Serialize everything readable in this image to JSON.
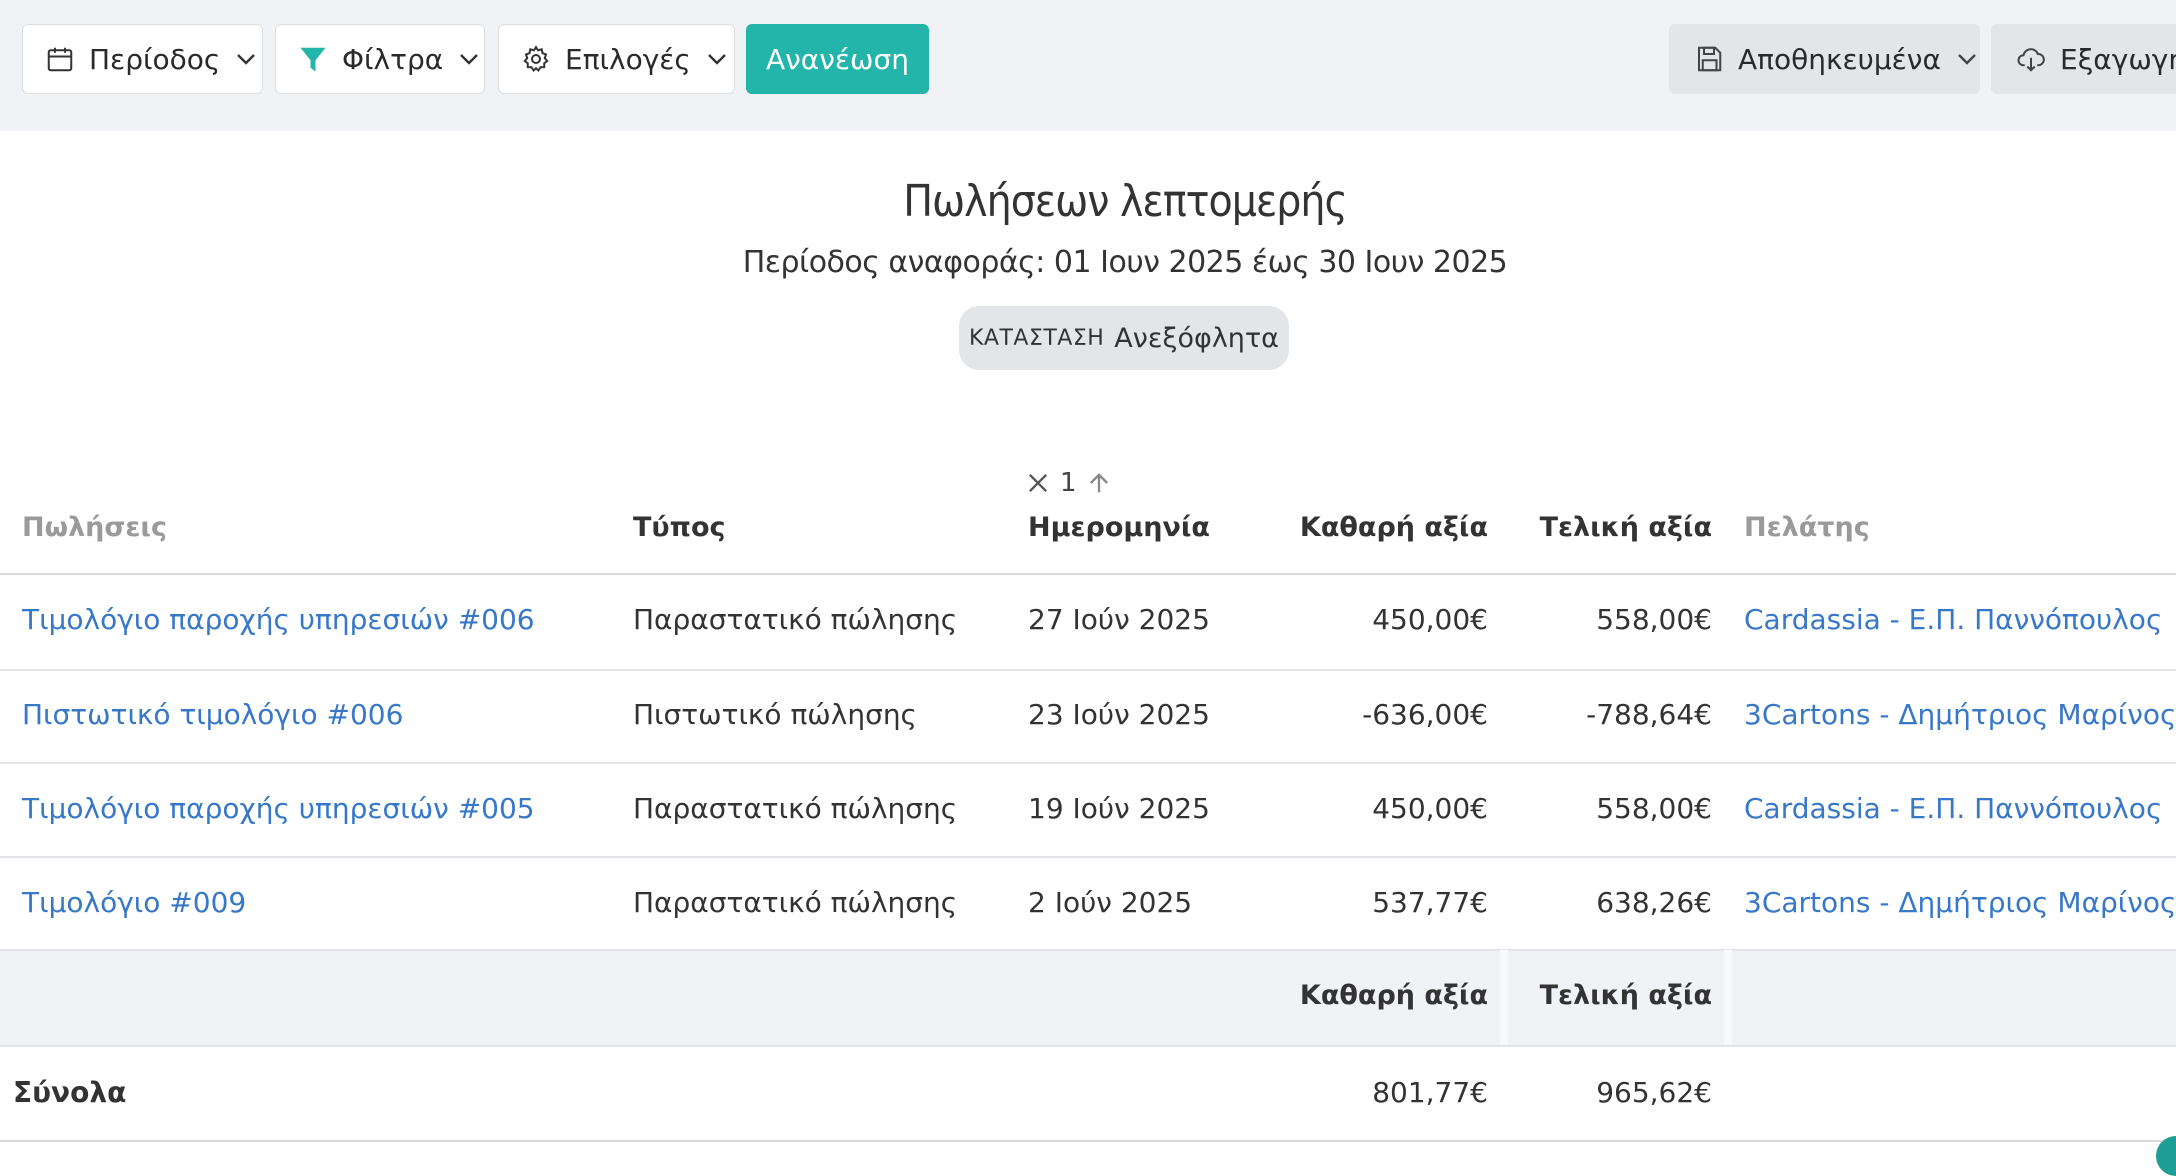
{
  "toolbar": {
    "period_label": "Περίοδος",
    "filters_label": "Φίλτρα",
    "options_label": "Επιλογές",
    "refresh_label": "Ανανέωση",
    "saved_label": "Αποθηκευμένα",
    "export_label": "Εξαγωγή"
  },
  "report": {
    "title": "Πωλήσεων λεπτομερής",
    "period": "Περίοδος αναφοράς: 01 Ιουν 2025 έως 30 Ιουν 2025",
    "status_key": "ΚΑΤΑΣΤΑΣΗ",
    "status_value": "Ανεξόφλητα"
  },
  "sort": {
    "order": "1"
  },
  "table": {
    "columns": {
      "sales": "Πωλήσεις",
      "type": "Τύπος",
      "date": "Ημερομηνία",
      "net": "Καθαρή αξία",
      "final": "Τελική αξία",
      "customer": "Πελάτης"
    },
    "rows": [
      {
        "sales": "Τιμολόγιο παροχής υπηρεσιών #006",
        "type": "Παραστατικό πώλησης",
        "date": "27 Ιούν 2025",
        "net": "450,00€",
        "final": "558,00€",
        "customer": "Cardassia - Ε.Π. Παννόπουλος"
      },
      {
        "sales": "Πιστωτικό τιμολόγιο #006",
        "type": "Πιστωτικό πώλησης",
        "date": "23 Ιούν 2025",
        "net": "-636,00€",
        "final": "-788,64€",
        "customer": "3Cartons - Δημήτριος Μαρίνος"
      },
      {
        "sales": "Τιμολόγιο παροχής υπηρεσιών #005",
        "type": "Παραστατικό πώλησης",
        "date": "19 Ιούν 2025",
        "net": "450,00€",
        "final": "558,00€",
        "customer": "Cardassia - Ε.Π. Παννόπουλος"
      },
      {
        "sales": "Τιμολόγιο #009",
        "type": "Παραστατικό πώλησης",
        "date": "2 Ιούν 2025",
        "net": "537,77€",
        "final": "638,26€",
        "customer": "3Cartons - Δημήτριος Μαρίνος"
      }
    ],
    "summary": {
      "net_header": "Καθαρή αξία",
      "final_header": "Τελική αξία",
      "label": "Σύνολα",
      "net_total": "801,77€",
      "final_total": "965,62€"
    }
  },
  "colors": {
    "accent": "#23b5a9",
    "link": "#3878c8",
    "toolbar_bg": "#f1f2f6"
  }
}
